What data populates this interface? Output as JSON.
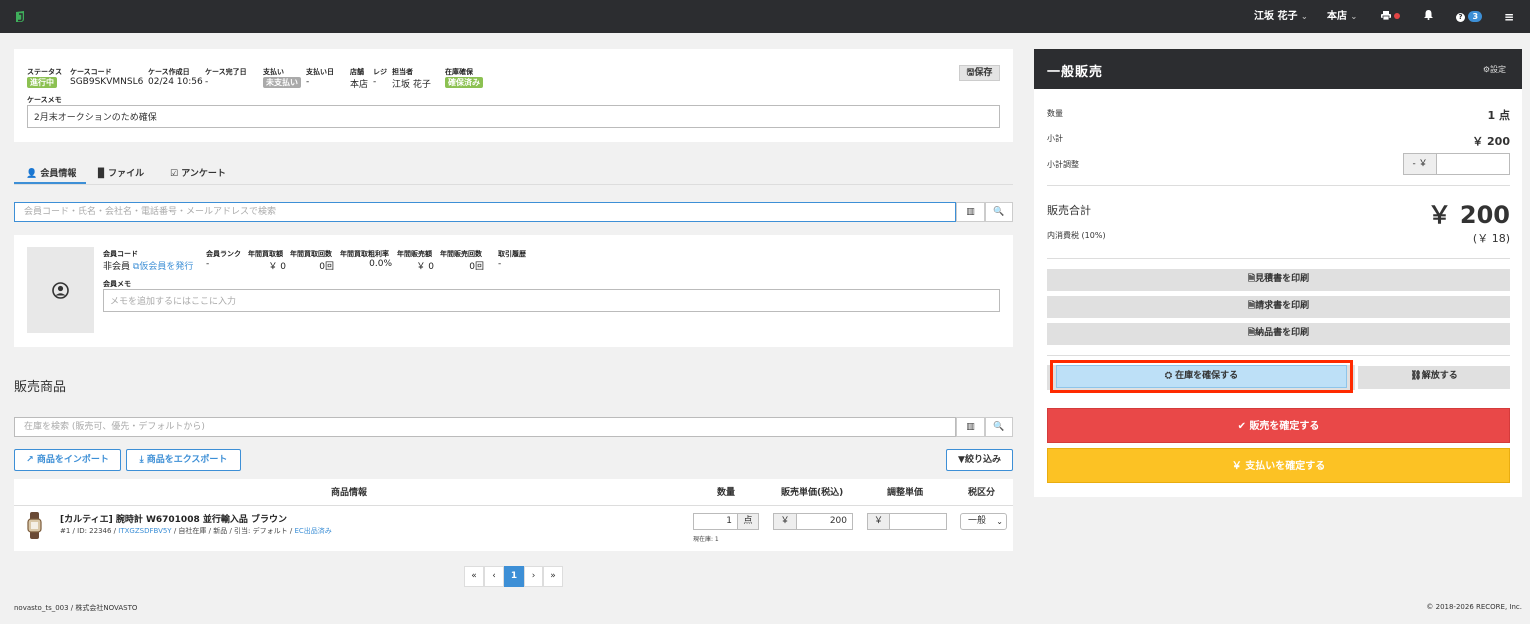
{
  "topbar": {
    "user": "江坂 花子",
    "store": "本店",
    "notif_count": "3"
  },
  "case": {
    "status_label": "ステータス",
    "status": "進行中",
    "code_label": "ケースコード",
    "code": "SGB9SKVMNSL6",
    "created_label": "ケース作成日",
    "created": "02/24 10:56",
    "completed_label": "ケース完了日",
    "completed": "-",
    "payment_label": "支払い",
    "payment": "未支払い",
    "paydate_label": "支払い日",
    "paydate": "-",
    "store_label": "店舗",
    "store": "本店",
    "register_label": "レジ",
    "register": "-",
    "staff_label": "担当者",
    "staff": "江坂 花子",
    "stock_label": "在庫確保",
    "stock": "確保済み",
    "memo_label": "ケースメモ",
    "memo": "2月末オークションのため確保",
    "save_label": "保存"
  },
  "tabs": [
    "会員情報",
    "ファイル",
    "アンケート"
  ],
  "member_search": {
    "placeholder": "会員コード・氏名・会社名・電話番号・メールアドレスで検索"
  },
  "member": {
    "code_label": "会員コード",
    "code": "非会員",
    "issue_link": "仮会員を発行",
    "rank_label": "会員ランク",
    "rank": "-",
    "buy_amount_label": "年間買取額",
    "buy_amount": "￥ 0",
    "buy_count_label": "年間買取回数",
    "buy_count": "0回",
    "buy_margin_label": "年間買取粗利率",
    "buy_margin": "0.0%",
    "sale_amount_label": "年間販売額",
    "sale_amount": "￥ 0",
    "sale_count_label": "年間販売回数",
    "sale_count": "0回",
    "history_label": "取引履歴",
    "history": "-",
    "memo_label": "会員メモ",
    "memo_placeholder": "メモを追加するにはここに入力"
  },
  "products": {
    "title": "販売商品",
    "search_placeholder": "在庫を検索 (販売可、優先・デフォルトから)",
    "import_label": "商品をインポート",
    "export_label": "商品をエクスポート",
    "filter_label": "絞り込み",
    "columns": {
      "info": "商品情報",
      "qty": "数量",
      "price": "販売単価(税込)",
      "adjust": "調整単価",
      "tax": "税区分"
    },
    "rows": [
      {
        "name": "[カルティエ] 腕時計 W6701008 並行輸入品 ブラウン",
        "meta_prefix": "#1 / ID: 22346 /",
        "sku": "ITXGZSDFBV5Y",
        "meta_mid": "/ 自社在庫 / 新品 / 引当: デフォルト /",
        "ec": "EC出品済み",
        "qty": "1",
        "qty_unit": "点",
        "stock_note": "現在庫: 1",
        "yen": "￥",
        "price": "200",
        "adjust": "",
        "tax": "一般"
      }
    ]
  },
  "pagination": {
    "first": "«",
    "prev": "‹",
    "current": "1",
    "next": "›",
    "last": "»"
  },
  "footer": {
    "left": "novasto_ts_003 / 株式会社NOVASTO",
    "right": "© 2018-2026 RECORE, Inc."
  },
  "sale": {
    "title": "一般販売",
    "settings_label": "設定",
    "qty_label": "数量",
    "qty": "1 点",
    "subtotal_label": "小計",
    "subtotal": "￥ 200",
    "adjust_label": "小計調整",
    "adjust_prefix": "- ￥",
    "adjust_value": "",
    "total_label": "販売合計",
    "total": "￥ 200",
    "tax_label": "内消費税 (10%)",
    "tax": "(￥ 18)",
    "estimate_label": "見積書を印刷",
    "invoice_label": "請求書を印刷",
    "delivery_label": "納品書を印刷",
    "reserve_label": "在庫を確保する",
    "release_label": "解放する",
    "confirm_sale_label": "販売を確定する",
    "confirm_pay_label": "￥ 支払いを確定する"
  },
  "colors": {
    "topbar": "#2c2d30",
    "accent": "#3d8fd6",
    "danger": "#e94848",
    "warning": "#fcc224",
    "success": "#8cc152",
    "highlight": "#ff2a00"
  }
}
